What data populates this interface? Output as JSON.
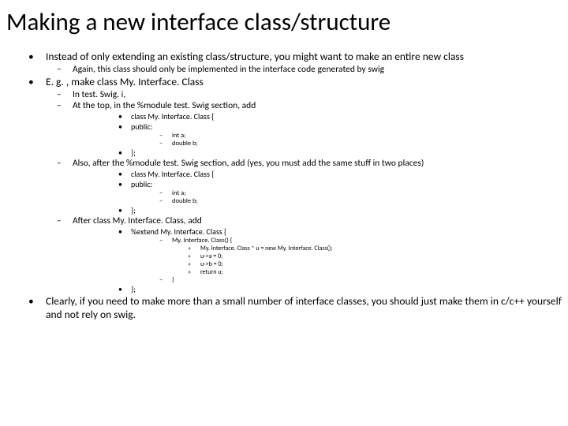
{
  "title": "Making a new interface class/structure",
  "b1": "Instead of only extending an existing class/structure, you might want to make an entire new class",
  "b1a": "Again, this class should only be implemented in the interface code generated by swig",
  "b2": "E. g. , make class My. Interface. Class",
  "b2a": "In test. Swig. i,",
  "b2b": "At the top, in the %module test. Swig section, add",
  "c1": "class My. Interface. Class {",
  "c2": "public:",
  "c2a": "int a;",
  "c2b": "double b;",
  "c3": "};",
  "b2c": "Also, after the %module test. Swig section, add (yes, you must add the same stuff in two places)",
  "b2d": "After class My. Interface. Class, add",
  "e1": "%extend My. Interface. Class {",
  "e2": "My. Interface. Class() {",
  "e2a": "My. Interface. Class * u = new My. Interface. Class();",
  "e2b": "u->a = 0;",
  "e2c": "u->b = 0;",
  "e2d": "return u;",
  "e3": "}",
  "e4": "};",
  "b3": "Clearly, if you need to make more than a small number of interface classes, you should just make them in c/c++ yourself and not rely on swig."
}
